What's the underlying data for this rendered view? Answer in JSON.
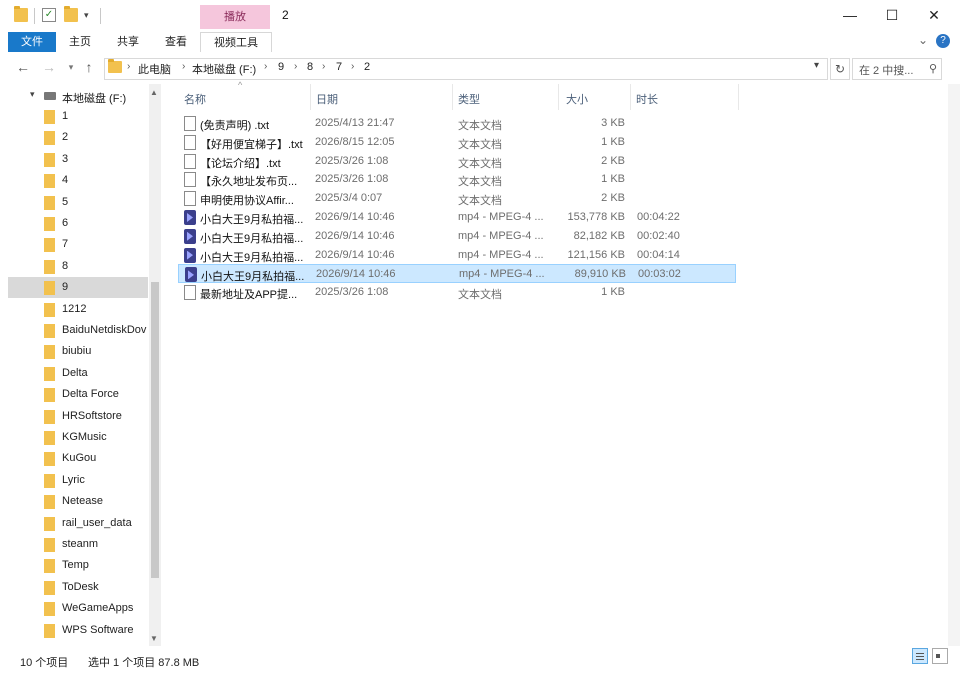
{
  "window": {
    "title": "2",
    "context_tab": "播放",
    "minimize": "—",
    "maximize": "☐",
    "close": "✕"
  },
  "ribbon": {
    "tabs": [
      "文件",
      "主页",
      "共享",
      "查看",
      "视频工具"
    ],
    "collapse": "⌄",
    "help": "?"
  },
  "address": {
    "crumbs": [
      "此电脑",
      "本地磁盘 (F:)",
      "9",
      "8",
      "7",
      "2"
    ],
    "search_placeholder": "在 2 中搜..."
  },
  "nav_pane": {
    "drive": "本地磁盘 (F:)",
    "folders": [
      "1",
      "2",
      "3",
      "4",
      "5",
      "6",
      "7",
      "8",
      "9",
      "1212",
      "BaiduNetdiskDov",
      "biubiu",
      "Delta",
      "Delta Force",
      "HRSoftstore",
      "KGMusic",
      "KuGou",
      "Lyric",
      "Netease",
      "rail_user_data",
      "steanm",
      "Temp",
      "ToDesk",
      "WeGameApps",
      "WPS Software"
    ],
    "selected_index": 8
  },
  "columns": {
    "name": "名称",
    "date": "日期",
    "type": "类型",
    "size": "大小",
    "duration": "时长"
  },
  "files": [
    {
      "icon": "text-file-icon",
      "name": "(免责声明) .txt",
      "date": "2025/4/13 21:47",
      "type": "文本文档",
      "size": "3 KB",
      "duration": ""
    },
    {
      "icon": "text-file-icon",
      "name": "【好用便宜梯子】.txt",
      "date": "2026/8/15 12:05",
      "type": "文本文档",
      "size": "1 KB",
      "duration": ""
    },
    {
      "icon": "text-file-icon",
      "name": "【论坛介绍】.txt",
      "date": "2025/3/26 1:08",
      "type": "文本文档",
      "size": "2 KB",
      "duration": ""
    },
    {
      "icon": "text-file-icon",
      "name": "【永久地址发布页...",
      "date": "2025/3/26 1:08",
      "type": "文本文档",
      "size": "1 KB",
      "duration": ""
    },
    {
      "icon": "text-file-icon",
      "name": "申明使用协议Affir...",
      "date": "2025/3/4 0:07",
      "type": "文本文档",
      "size": "2 KB",
      "duration": ""
    },
    {
      "icon": "video-file-icon",
      "name": "小白大王9月私拍福...",
      "date": "2026/9/14 10:46",
      "type": "mp4 - MPEG-4 ...",
      "size": "153,778 KB",
      "duration": "00:04:22"
    },
    {
      "icon": "video-file-icon",
      "name": "小白大王9月私拍福...",
      "date": "2026/9/14 10:46",
      "type": "mp4 - MPEG-4 ...",
      "size": "82,182 KB",
      "duration": "00:02:40"
    },
    {
      "icon": "video-file-icon",
      "name": "小白大王9月私拍福...",
      "date": "2026/9/14 10:46",
      "type": "mp4 - MPEG-4 ...",
      "size": "121,156 KB",
      "duration": "00:04:14"
    },
    {
      "icon": "video-file-icon",
      "name": "小白大王9月私拍福...",
      "date": "2026/9/14 10:46",
      "type": "mp4 - MPEG-4 ...",
      "size": "89,910 KB",
      "duration": "00:03:02"
    },
    {
      "icon": "text-file-icon",
      "name": "最新地址及APP提...",
      "date": "2025/3/26 1:08",
      "type": "文本文档",
      "size": "1 KB",
      "duration": ""
    }
  ],
  "selected_file_index": 8,
  "status": {
    "count": "10 个项目",
    "selected": "选中 1 个项目  87.8 MB"
  },
  "colors": {
    "file_tab": "#1979ca",
    "context_tab": "#f5c6dc",
    "selection": "#cce8ff"
  }
}
